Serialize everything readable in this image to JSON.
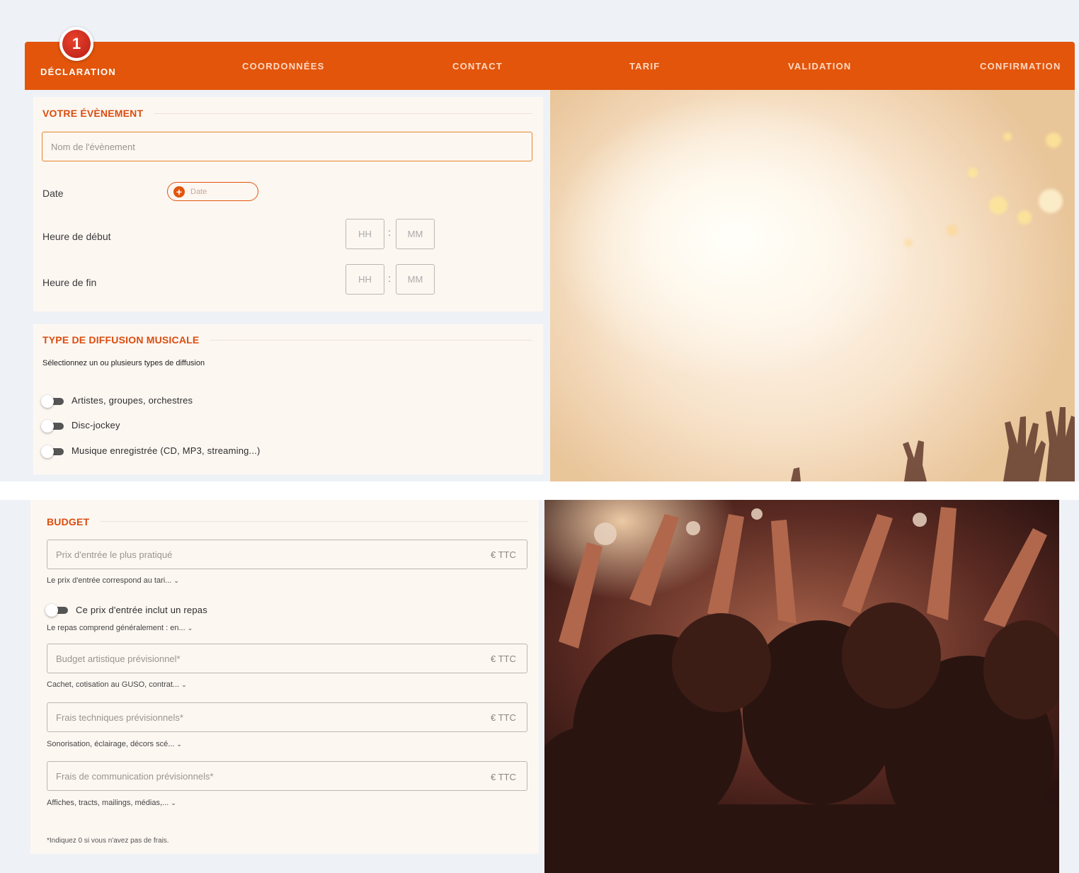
{
  "steps": [
    {
      "number": "1",
      "label": "DÉCLARATION"
    },
    {
      "label": "COORDONNÉES"
    },
    {
      "label": "CONTACT"
    },
    {
      "label": "TARIF"
    },
    {
      "label": "VALIDATION"
    },
    {
      "label": "CONFIRMATION"
    }
  ],
  "event": {
    "title": "VOTRE ÉVÈNEMENT",
    "name_placeholder": "Nom de l'évènement",
    "date_label": "Date",
    "date_button": "Date",
    "start_label": "Heure de début",
    "end_label": "Heure de fin",
    "hh_placeholder": "HH",
    "mm_placeholder": "MM",
    "colon": ":"
  },
  "diffusion": {
    "title": "TYPE DE DIFFUSION MUSICALE",
    "subtitle": "Sélectionnez un ou plusieurs types de diffusion",
    "options": [
      {
        "label": "Artistes, groupes, orchestres",
        "checked": false
      },
      {
        "label": "Disc-jockey",
        "checked": false
      },
      {
        "label": "Musique enregistrée (CD, MP3, streaming...)",
        "checked": false
      }
    ]
  },
  "budget": {
    "title": "BUDGET",
    "currency_suffix": "€ TTC",
    "entry_price_placeholder": "Prix d'entrée le plus pratiqué",
    "entry_price_help": "Le prix d'entrée correspond au tari...",
    "meal_toggle_label": "Ce prix d'entrée inclut un repas",
    "meal_help": "Le repas comprend généralement : en...",
    "artistic_placeholder": "Budget artistique prévisionnel*",
    "artistic_help": "Cachet, cotisation au GUSO, contrat...",
    "technical_placeholder": "Frais techniques prévisionnels*",
    "technical_help": "Sonorisation, éclairage, décors scé...",
    "communication_placeholder": "Frais de communication prévisionnels*",
    "communication_help": "Affiches, tracts, mailings, médias,...",
    "chevron": "⌄",
    "footnote": "*Indiquez 0 si vous n'avez pas de frais."
  },
  "colors": {
    "accent": "#e2550b",
    "section_title": "#d94d0f",
    "panel_bg": "#fdf7f2",
    "page_bg": "#eef2f7"
  }
}
